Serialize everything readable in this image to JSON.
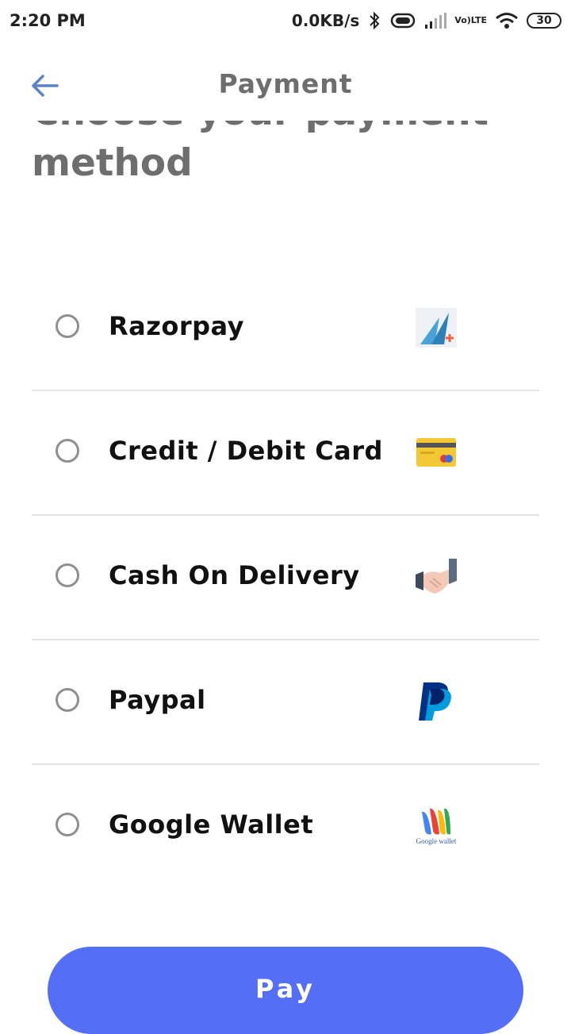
{
  "status_bar": {
    "time": "2:20 PM",
    "net_speed": "0.0KB/s",
    "network_label_top": "Vo)",
    "network_label_bottom": "LTE",
    "battery": "30"
  },
  "header": {
    "title": "Payment",
    "back_icon": "back-arrow-icon"
  },
  "heading": {
    "line1": "Choose your payment",
    "line2": "method"
  },
  "payment_options": [
    {
      "label": "Razorpay",
      "icon": "razorpay-logo-icon",
      "selected": false
    },
    {
      "label": "Credit / Debit Card",
      "icon": "credit-card-icon",
      "selected": false
    },
    {
      "label": "Cash On Delivery",
      "icon": "handshake-icon",
      "selected": false
    },
    {
      "label": "Paypal",
      "icon": "paypal-logo-icon",
      "selected": false
    },
    {
      "label": "Google Wallet",
      "icon": "google-wallet-logo-icon",
      "icon_text": "Google wallet",
      "selected": false
    }
  ],
  "pay_button": {
    "label": "Pay"
  },
  "colors": {
    "accent": "#546ef5",
    "back_arrow": "#5a83c9",
    "title_gray": "#6e6e6e",
    "divider": "#e3e3e3"
  }
}
